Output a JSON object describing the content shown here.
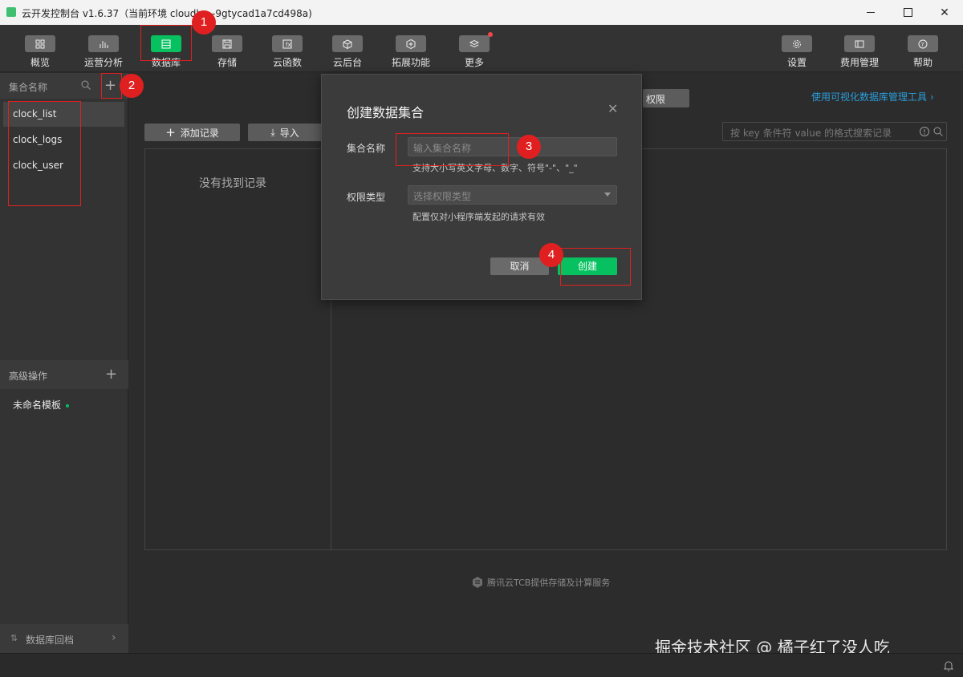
{
  "window": {
    "title": "云开发控制台 v1.6.37（当前环境 cloudb…-9gtycad1a7cd498a)"
  },
  "toolbar": {
    "items": [
      {
        "label": "概览",
        "icon": "grid-icon"
      },
      {
        "label": "运营分析",
        "icon": "bar-chart-icon"
      },
      {
        "label": "数据库",
        "icon": "database-icon",
        "active": true
      },
      {
        "label": "存储",
        "icon": "save-icon"
      },
      {
        "label": "云函数",
        "icon": "function-icon"
      },
      {
        "label": "云后台",
        "icon": "cube-icon"
      },
      {
        "label": "拓展功能",
        "icon": "extension-icon"
      },
      {
        "label": "更多",
        "icon": "layers-icon",
        "badge": true
      },
      {
        "label": "设置",
        "icon": "gear-icon"
      },
      {
        "label": "费用管理",
        "icon": "wallet-icon"
      },
      {
        "label": "帮助",
        "icon": "help-icon"
      }
    ]
  },
  "sidebar": {
    "header_label": "集合名称",
    "collections": [
      "clock_list",
      "clock_logs",
      "clock_user"
    ],
    "advanced_label": "高级操作",
    "template_label": "未命名模板",
    "rollback_label": "数据库回档"
  },
  "main": {
    "permission_label": "权限",
    "viz_link": "使用可视化数据库管理工具 ›",
    "add_record_label": "添加记录",
    "import_label": "导入",
    "search_placeholder": "按 key 条件符 value 的格式搜索记录",
    "empty_text": "没有找到记录",
    "footer_note": "腾讯云TCB提供存储及计算服务"
  },
  "modal": {
    "title": "创建数据集合",
    "name_label": "集合名称",
    "name_placeholder": "输入集合名称",
    "name_hint": "支持大小写英文字母、数字、符号\"-\"、\"_\"",
    "perm_label": "权限类型",
    "perm_placeholder": "选择权限类型",
    "perm_hint": "配置仅对小程序端发起的请求有效",
    "cancel_label": "取消",
    "create_label": "创建"
  },
  "annotations": [
    "1",
    "2",
    "3",
    "4"
  ],
  "watermark": "掘金技术社区 @ 橘子红了没人吃",
  "colors": {
    "accent": "#07c160",
    "annotation": "#e02020",
    "link": "#2a9ddb"
  }
}
